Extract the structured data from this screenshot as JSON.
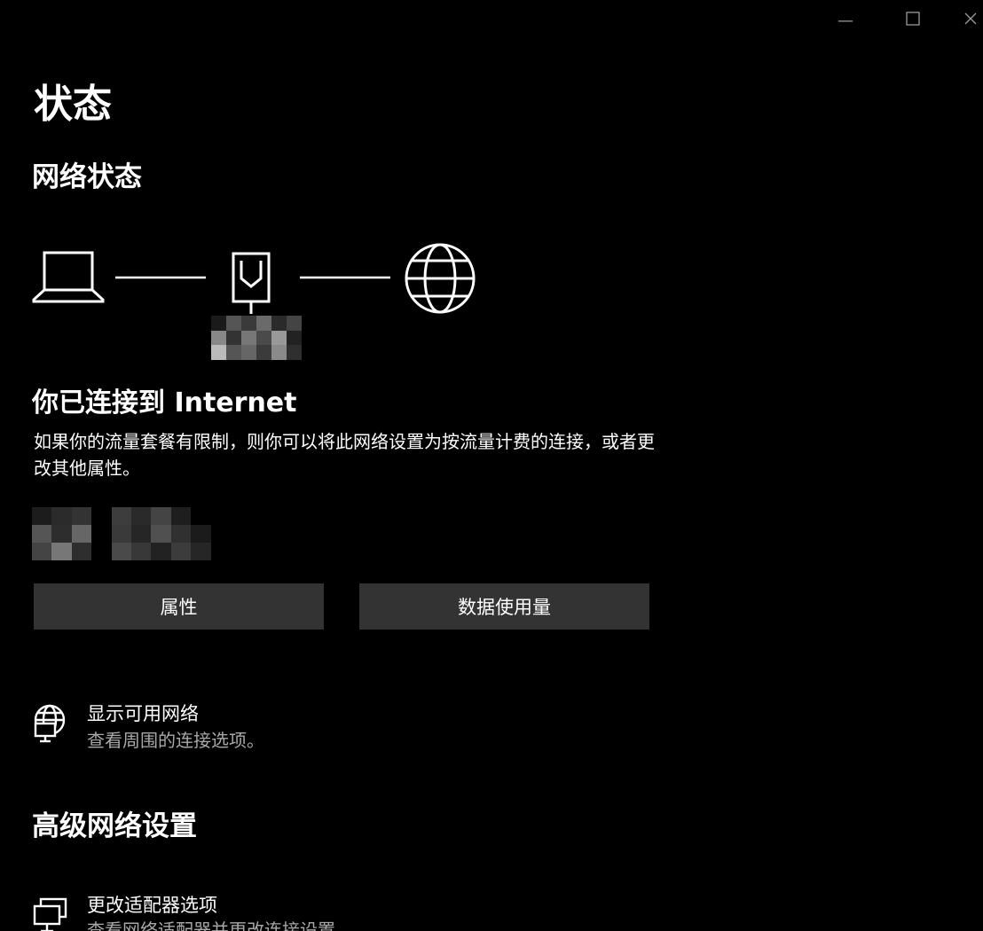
{
  "window": {
    "minimize_glyph": "—",
    "maximize_glyph": "☐",
    "close_glyph": "✕"
  },
  "page": {
    "title": "状态",
    "section_title": "网络状态"
  },
  "diagram": {
    "icons": [
      "laptop-icon",
      "ethernet-adapter-icon",
      "globe-icon"
    ]
  },
  "status": {
    "heading": "你已连接到 Internet",
    "description": "如果你的流量套餐有限制，则你可以将此网络设置为按流量计费的连接，或者更改其他属性。"
  },
  "buttons": {
    "properties": "属性",
    "data_usage": "数据使用量"
  },
  "show_networks": {
    "icon": "globe-network-icon",
    "title": "显示可用网络",
    "subtitle": "查看周围的连接选项。"
  },
  "advanced": {
    "title": "高级网络设置"
  },
  "adapter_options": {
    "icon": "network-adapter-icon",
    "title": "更改适配器选项",
    "subtitle": "查看网络适配器并更改连接设置。"
  },
  "colors": {
    "background": "#000000",
    "button": "#333333",
    "secondary_text": "#a8a8a8"
  }
}
